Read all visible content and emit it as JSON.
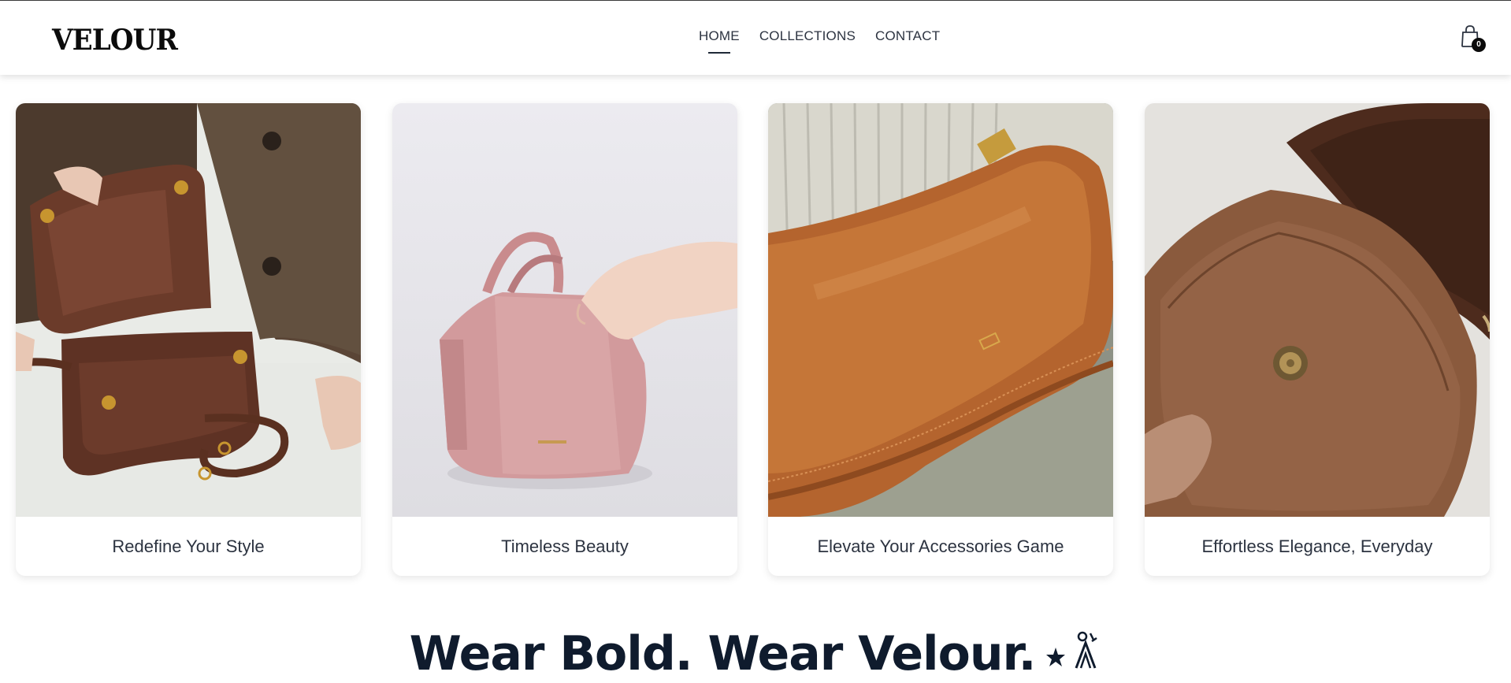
{
  "brand": {
    "logo_text": "VELOUR"
  },
  "nav": {
    "items": [
      {
        "label": "HOME",
        "active": true
      },
      {
        "label": "COLLECTIONS",
        "active": false
      },
      {
        "label": "CONTACT",
        "active": false
      }
    ]
  },
  "cart": {
    "icon": "shopping-bag-icon",
    "count": "0"
  },
  "cards": [
    {
      "caption": "Redefine Your Style",
      "image": "brown-crossbody-bag-photo"
    },
    {
      "caption": "Timeless Beauty",
      "image": "pink-tote-bag-photo"
    },
    {
      "caption": "Elevate Your Accessories Game",
      "image": "tan-leather-baguette-photo"
    },
    {
      "caption": "Effortless Elegance, Everyday",
      "image": "brown-saddle-bag-photo"
    }
  ],
  "hero": {
    "tagline": "Wear Bold. Wear Velour.",
    "decoration": "sparkle-doodle-icon"
  },
  "colors": {
    "text_dark": "#0f1b2d",
    "nav_text": "#2c3340",
    "badge_bg": "#0b0b0b",
    "page_bg": "#ffffff"
  }
}
